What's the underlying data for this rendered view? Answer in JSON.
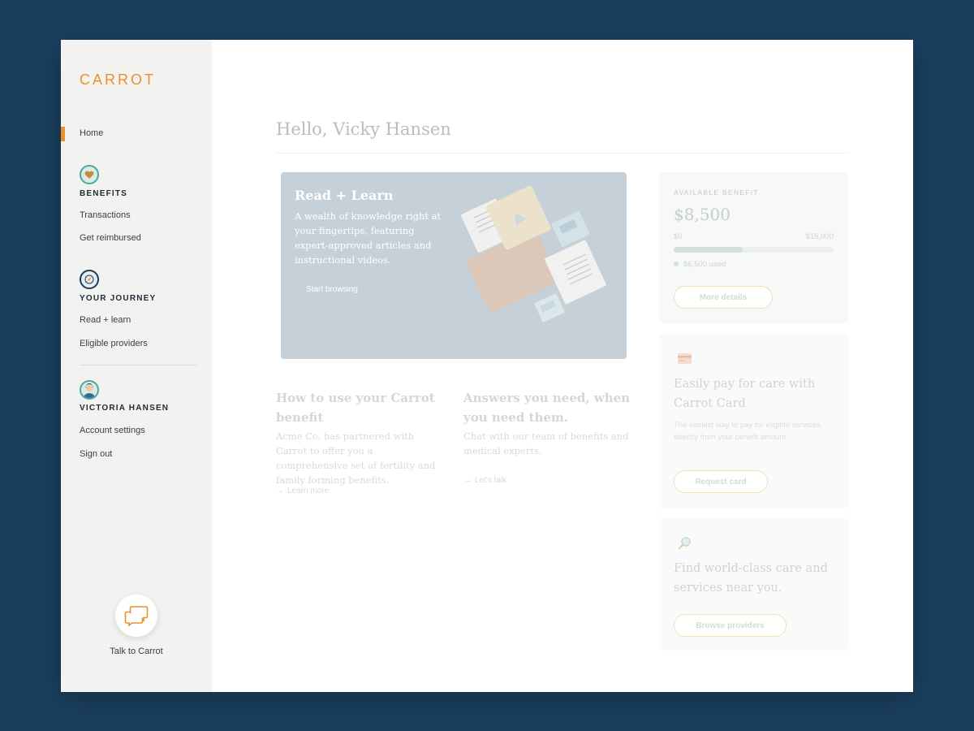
{
  "sidebar": {
    "logo": "CARROT",
    "home": "Home",
    "benefits": {
      "title": "BENEFITS",
      "items": [
        "Transactions",
        "Get reimbursed"
      ]
    },
    "journey": {
      "title": "YOUR JOURNEY",
      "items": [
        "Read + learn",
        "Eligible providers"
      ]
    },
    "account": {
      "title": "VICTORIA HANSEN",
      "items": [
        "Account settings",
        "Sign out"
      ]
    },
    "talk_label": "Talk to Carrot"
  },
  "main": {
    "greeting": "Hello, Vicky Hansen",
    "hero": {
      "title": "Read + Learn",
      "text": "A wealth of knowledge right at your fingertips, featuring expert-approved articles and instructional videos.",
      "link": "Start browsing"
    },
    "columns": [
      {
        "title": "How to use your Carrot benefit",
        "text": "Acme Co. has partnered with Carrot to offer you a comprehensive set of fertility and family forming benefits.",
        "link": "Learn more"
      },
      {
        "title": "Answers you need, when you need them.",
        "text": "Chat with our team of benefits and medical experts.",
        "link": "Let's talk"
      }
    ]
  },
  "benefit": {
    "kicker": "AVAILABLE BENEFIT",
    "amount": "$8,500",
    "min": "$0",
    "max": "$15,000",
    "used_fraction": 0.433,
    "used": "$6,500 used",
    "button": "More details"
  },
  "card_offer": {
    "title": "Easily pay for care with Carrot Card",
    "text": "The easiest way to pay for eligible services, directly from your benefit amount.",
    "button": "Request card"
  },
  "providers": {
    "title": "Find world-class care and services near you.",
    "button": "Browse providers"
  },
  "colors": {
    "accent": "#e8922e",
    "background": "#1a3f5e",
    "sidebar": "#f2f2f0",
    "hero": "#c6d0d8"
  },
  "icons": {
    "benefits": "heart-icon",
    "journey": "compass-icon",
    "account": "avatar-icon",
    "talk": "chat-bubbles-icon",
    "card": "credit-card-icon",
    "search": "magnifier-icon",
    "link": "arrow-right-icon"
  }
}
